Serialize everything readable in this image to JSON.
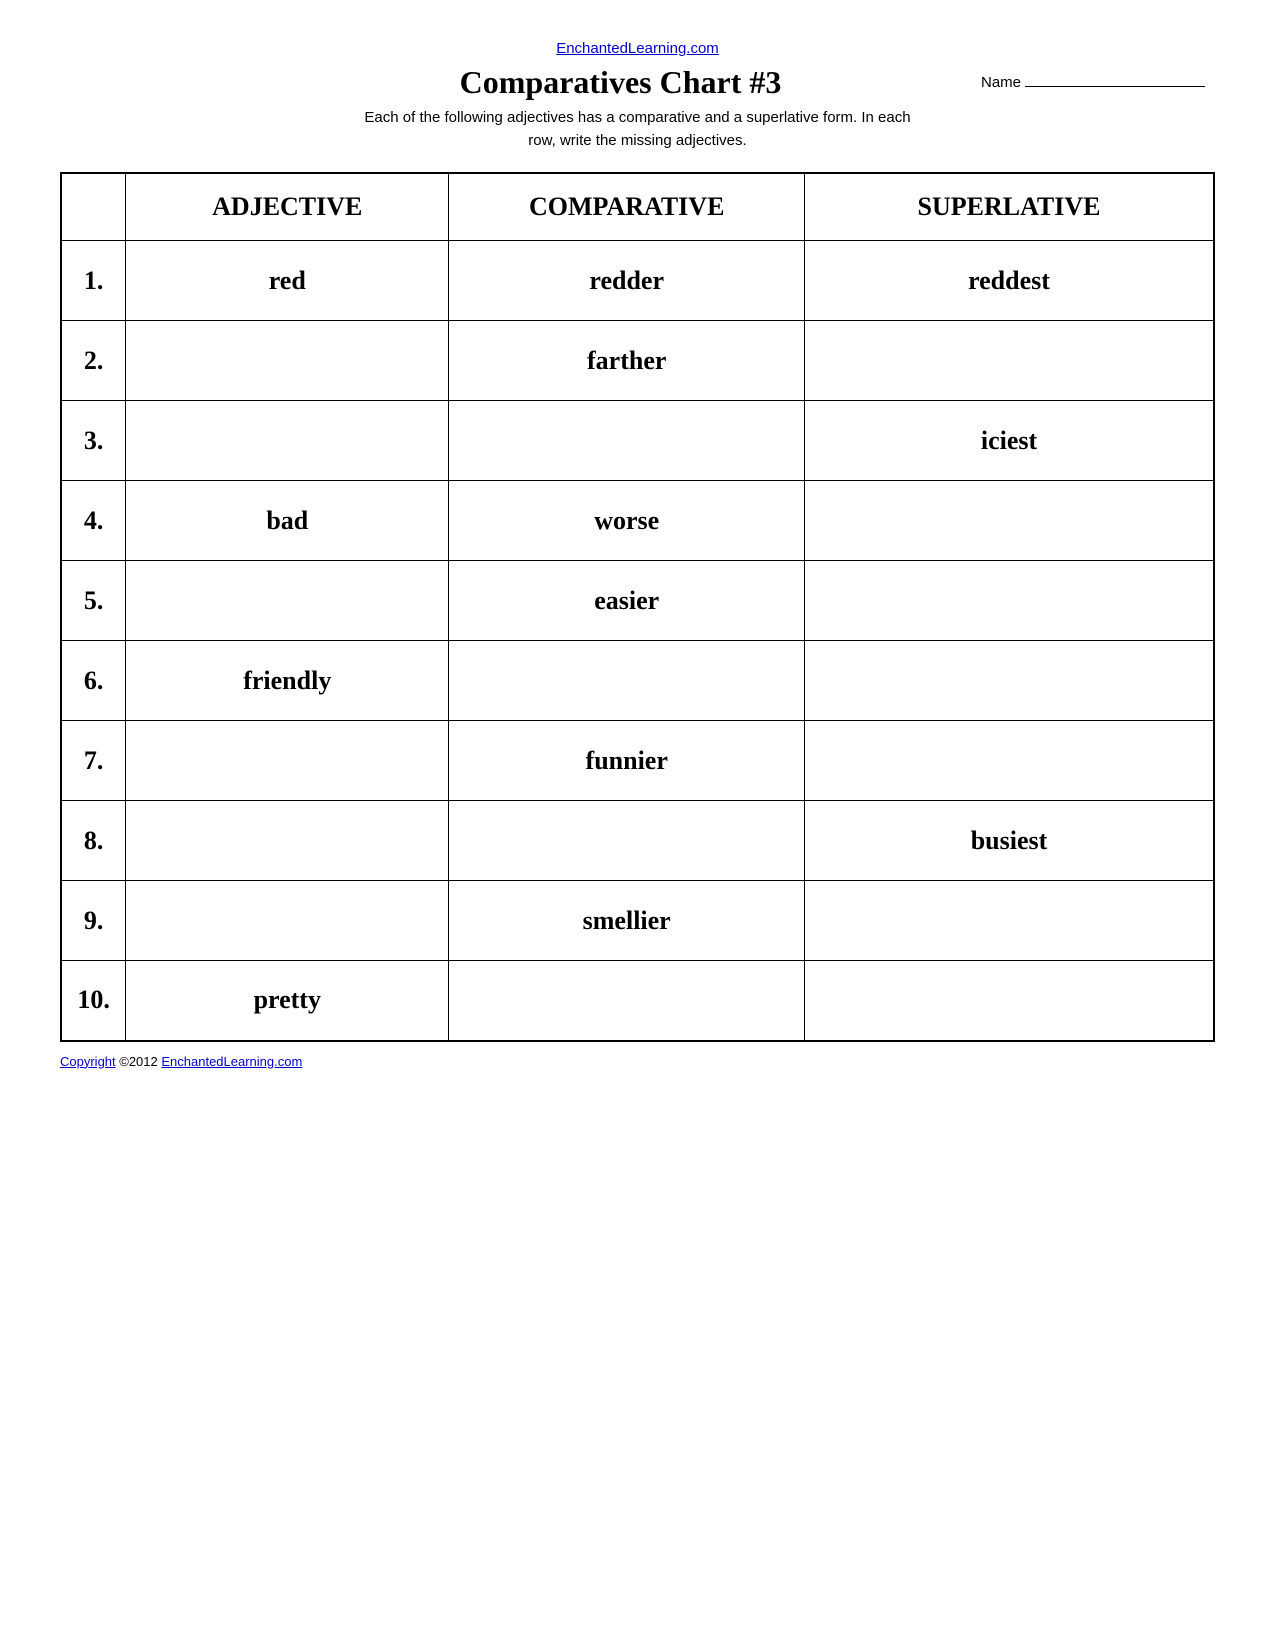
{
  "header": {
    "site_url_text": "EnchantedLearning.com",
    "title": "Comparatives Chart #3",
    "name_label": "Name",
    "subtitle_line1": "Each of the following adjectives has a comparative and a superlative form. In each",
    "subtitle_line2": "row, write the missing adjectives."
  },
  "table": {
    "headers": [
      "ADJECTIVE",
      "COMPARATIVE",
      "SUPERLATIVE"
    ],
    "rows": [
      {
        "num": "1.",
        "adjective": "red",
        "comparative": "redder",
        "superlative": "reddest"
      },
      {
        "num": "2.",
        "adjective": "",
        "comparative": "farther",
        "superlative": ""
      },
      {
        "num": "3.",
        "adjective": "",
        "comparative": "",
        "superlative": "iciest"
      },
      {
        "num": "4.",
        "adjective": "bad",
        "comparative": "worse",
        "superlative": ""
      },
      {
        "num": "5.",
        "adjective": "",
        "comparative": "easier",
        "superlative": ""
      },
      {
        "num": "6.",
        "adjective": "friendly",
        "comparative": "",
        "superlative": ""
      },
      {
        "num": "7.",
        "adjective": "",
        "comparative": "funnier",
        "superlative": ""
      },
      {
        "num": "8.",
        "adjective": "",
        "comparative": "",
        "superlative": "busiest"
      },
      {
        "num": "9.",
        "adjective": "",
        "comparative": "smellier",
        "superlative": ""
      },
      {
        "num": "10.",
        "adjective": "pretty",
        "comparative": "",
        "superlative": ""
      }
    ]
  },
  "footer": {
    "copyright_text": "Copyright",
    "year_and_site": " ©2012 EnchantedLearning.com"
  }
}
